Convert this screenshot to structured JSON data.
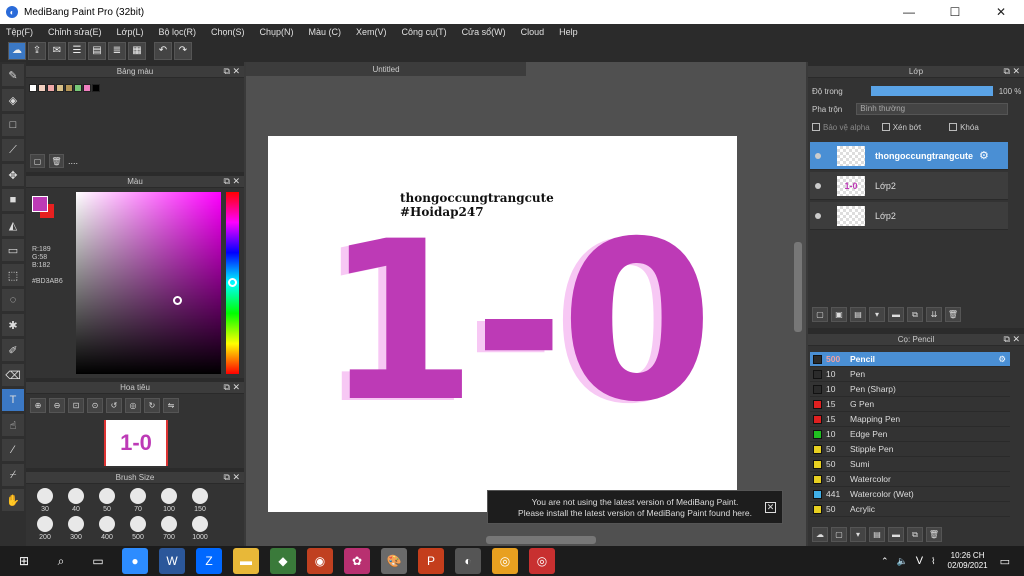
{
  "window": {
    "title": "MediBang Paint Pro (32bit)",
    "minimize": "—",
    "maximize": "☐",
    "close": "✕"
  },
  "menu": [
    "Tệp(F)",
    "Chỉnh sửa(E)",
    "Lớp(L)",
    "Bộ lọc(R)",
    "Chọn(S)",
    "Chụp(N)",
    "Màu (C)",
    "Xem(V)",
    "Công cụ(T)",
    "Cửa sổ(W)",
    "Cloud",
    "Help"
  ],
  "panels": {
    "palette": {
      "title": "Bảng màu",
      "dots": "....",
      "swatches": [
        "#ffffff",
        "#f2d0c0",
        "#f0a8a8",
        "#d8c088",
        "#b89858",
        "#78c878",
        "#f080c0",
        "#000000"
      ]
    },
    "color": {
      "title": "Màu",
      "r": "R:189",
      "g": "G:58",
      "b": "B:182",
      "hex": "#BD3AB6",
      "foreground": "#BD3AB6",
      "background": "#e82020"
    },
    "navigator": {
      "title": "Hoa tiêu",
      "thumb_text": "1-0"
    },
    "brush_size": {
      "title": "Brush Size",
      "sizes": [
        "30",
        "40",
        "50",
        "70",
        "100",
        "150",
        "200",
        "300",
        "400",
        "500",
        "700",
        "1000"
      ]
    },
    "layers": {
      "title": "Lớp",
      "opacity_label": "Độ trong",
      "opacity_value": "100 %",
      "blend_label": "Pha trộn",
      "blend_value": "Bình thường",
      "protect_alpha": "Bảo vệ alpha",
      "clipping": "Xén bớt",
      "lock": "Khóa",
      "items": [
        {
          "name": "thongoccungtrangcute",
          "selected": true,
          "thumb": ""
        },
        {
          "name": "Lớp2",
          "selected": false,
          "thumb": "1-0"
        },
        {
          "name": "Lớp2",
          "selected": false,
          "thumb": ""
        }
      ]
    },
    "brushes": {
      "title": "Cọ: Pencil",
      "items": [
        {
          "size": "500",
          "name": "Pencil",
          "color": "#2b2b2b",
          "selected": true
        },
        {
          "size": "10",
          "name": "Pen",
          "color": "#2b2b2b",
          "selected": false
        },
        {
          "size": "10",
          "name": "Pen (Sharp)",
          "color": "#2b2b2b",
          "selected": false
        },
        {
          "size": "15",
          "name": "G Pen",
          "color": "#e02020",
          "selected": false
        },
        {
          "size": "15",
          "name": "Mapping Pen",
          "color": "#e02020",
          "selected": false
        },
        {
          "size": "10",
          "name": "Edge Pen",
          "color": "#20c020",
          "selected": false
        },
        {
          "size": "50",
          "name": "Stipple Pen",
          "color": "#e8d020",
          "selected": false
        },
        {
          "size": "50",
          "name": "Sumi",
          "color": "#e8d020",
          "selected": false
        },
        {
          "size": "50",
          "name": "Watercolor",
          "color": "#e8d020",
          "selected": false
        },
        {
          "size": "441",
          "name": "Watercolor (Wet)",
          "color": "#40b0e8",
          "selected": false
        },
        {
          "size": "50",
          "name": "Acrylic",
          "color": "#e8d020",
          "selected": false
        }
      ]
    }
  },
  "canvas": {
    "tab": "Untitled",
    "line1": "thongoccungtrangcute",
    "line2": "#Hoidap247",
    "big_text": "1-0",
    "accent": "#BD3AB6"
  },
  "notice": {
    "line1": "You are not using the latest version of MediBang Paint.",
    "line2": "Please install the latest version of MediBang Paint found here.",
    "close": "✕"
  },
  "taskbar": {
    "time": "10:26 CH",
    "date": "02/09/2021",
    "input_lang": "V"
  }
}
